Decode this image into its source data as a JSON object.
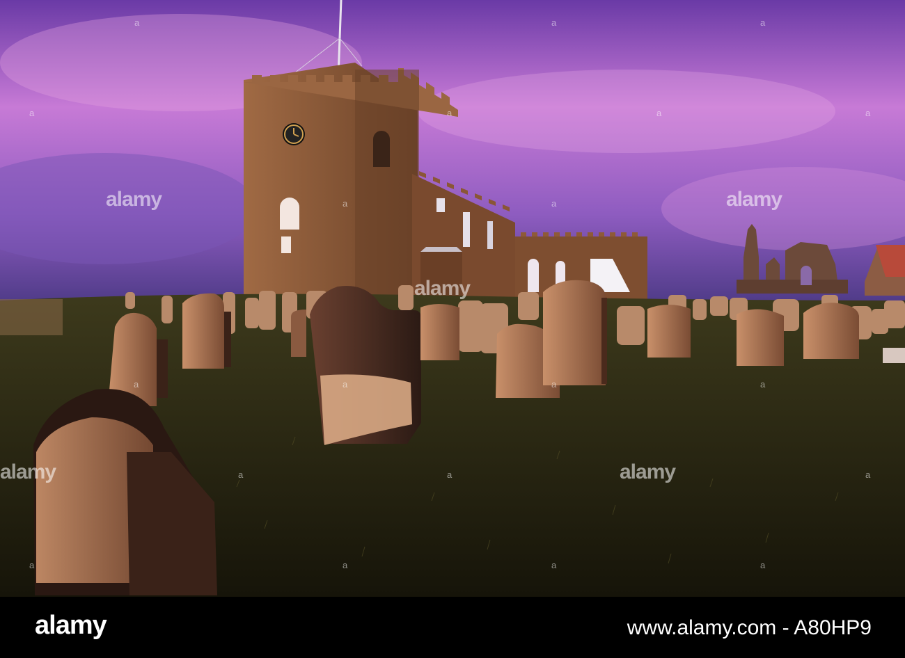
{
  "watermark": {
    "brand": "alamy",
    "marker": "a"
  },
  "footer": {
    "brand": "alamy",
    "image_id": "www.alamy.com - A80HP9"
  },
  "colors": {
    "sky_top": "#6e3fa8",
    "sky_mid": "#c978d8",
    "sky_horizon": "#5a3c8e",
    "stone": "#8a5a3a",
    "grass": "#2e2a12"
  }
}
